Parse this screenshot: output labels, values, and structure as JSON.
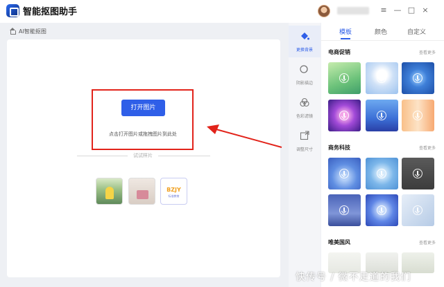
{
  "app": {
    "title": "智能抠图助手"
  },
  "window": {
    "buttons": [
      "≡",
      "—",
      "□",
      "×"
    ]
  },
  "breadcrumb": {
    "label": "AI智能抠图"
  },
  "upload": {
    "open_button": "打开图片",
    "hint": "点击打开图片或拖拽图片到此处",
    "samples_label": "试试样片",
    "sample3_text": "BZJY",
    "sample3_sub": "标准教育"
  },
  "tools": [
    {
      "label": "更换背景",
      "icon": "paint-bucket-icon"
    },
    {
      "label": "阴影描边",
      "icon": "shadow-icon"
    },
    {
      "label": "色彩滤镜",
      "icon": "color-filter-icon"
    },
    {
      "label": "调整尺寸",
      "icon": "resize-icon"
    }
  ],
  "tabs": [
    "模板",
    "颜色",
    "自定义"
  ],
  "active_tab": "模板",
  "sections": [
    {
      "title": "电商促销",
      "more": "查看更多"
    },
    {
      "title": "商务科技",
      "more": "查看更多"
    },
    {
      "title": "唯美国风",
      "more": "查看更多"
    }
  ],
  "colors": {
    "accent": "#2f5fe8",
    "highlight": "#e2231a"
  },
  "watermark": "快传号 / 微不足道的我们"
}
